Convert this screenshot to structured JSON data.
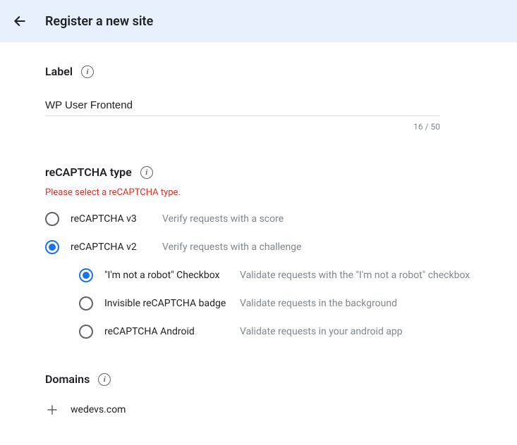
{
  "header": {
    "title": "Register a new site"
  },
  "label_section": {
    "title": "Label",
    "value": "WP User Frontend",
    "counter": "16 / 50"
  },
  "type_section": {
    "title": "reCAPTCHA type",
    "error": "Please select a reCAPTCHA type.",
    "options": [
      {
        "label": "reCAPTCHA v3",
        "desc": "Verify requests with a score"
      },
      {
        "label": "reCAPTCHA v2",
        "desc": "Verify requests with a challenge"
      }
    ],
    "sub_options": [
      {
        "label": "\"I'm not a robot\" Checkbox",
        "desc": "Validate requests with the \"I'm not a robot\" checkbox"
      },
      {
        "label": "Invisible reCAPTCHA badge",
        "desc": "Validate requests in the background"
      },
      {
        "label": "reCAPTCHA Android",
        "desc": "Validate requests in your android app"
      }
    ]
  },
  "domains_section": {
    "title": "Domains",
    "domain": "wedevs.com"
  }
}
